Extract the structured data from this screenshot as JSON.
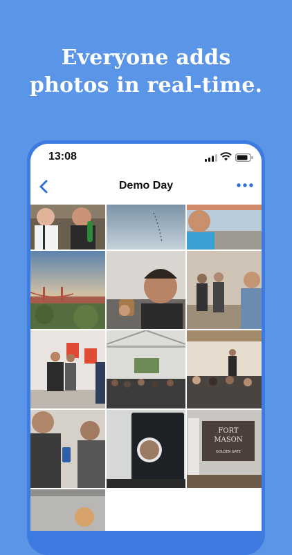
{
  "headline": {
    "line1": "Everyone adds",
    "line2": "photos in real-time."
  },
  "status_bar": {
    "time": "13:08",
    "icons": [
      "cellular-signal-icon",
      "wifi-icon",
      "battery-icon"
    ]
  },
  "nav": {
    "title": "Demo Day",
    "back_icon": "chevron-left-icon",
    "more_icon": "ellipsis-icon"
  },
  "colors": {
    "background": "#5b95e8",
    "phone_frame": "#3d7be0",
    "accent": "#2f6fd8"
  },
  "photos": [
    {
      "name": "photo-people-beer"
    },
    {
      "name": "photo-sky-birds"
    },
    {
      "name": "photo-selfie-bay"
    },
    {
      "name": "photo-golden-gate-sunset"
    },
    {
      "name": "photo-selfie-drink"
    },
    {
      "name": "photo-crowd-selfie"
    },
    {
      "name": "photo-two-men-booth"
    },
    {
      "name": "photo-hall-audience"
    },
    {
      "name": "photo-stage-audience"
    },
    {
      "name": "photo-men-phone"
    },
    {
      "name": "photo-laptop-video-call"
    },
    {
      "name": "photo-fort-mason-sign"
    },
    {
      "name": "photo-warehouse-ceiling"
    }
  ],
  "fort_mason_sign": {
    "line1": "FORT",
    "line2": "MASON",
    "line3": "GOLDEN GATE"
  }
}
